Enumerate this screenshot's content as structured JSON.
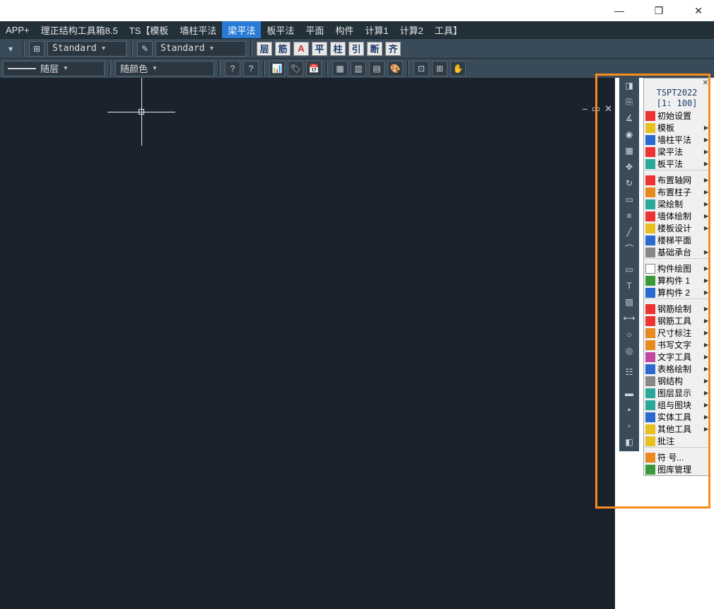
{
  "title_buttons": {
    "min": "—",
    "max": "❐",
    "close": "✕"
  },
  "menu": {
    "items": [
      "APP+",
      "理正结构工具箱8.5",
      "TS【模板",
      "墙柱平法",
      "梁平法",
      "板平法",
      "平面",
      "构件",
      "计算1",
      "计算2",
      "工具】"
    ],
    "active_index": 4
  },
  "toolbar1": {
    "style1": "Standard",
    "style2": "Standard",
    "labels": [
      "层",
      "筋",
      "A",
      "平",
      "柱",
      "引",
      "断",
      "齐"
    ]
  },
  "toolbar2": {
    "layer_line": "———",
    "layer_text": "随层",
    "color_text": "随颜色"
  },
  "canvas": {
    "ctrl_min": "–",
    "ctrl_sq": "▭",
    "ctrl_x": "✕"
  },
  "right_panel": {
    "title": "TSPT2022",
    "scale": "[1: 100]",
    "items": [
      {
        "label": "初始设置",
        "arrow": false,
        "c": "c-red"
      },
      {
        "label": "模板",
        "arrow": true,
        "c": "c-yel"
      },
      {
        "label": "墙柱平法",
        "arrow": true,
        "c": "c-blue"
      },
      {
        "label": "梁平法",
        "arrow": true,
        "c": "c-red"
      },
      {
        "label": "板平法",
        "arrow": true,
        "c": "c-teal"
      }
    ],
    "items2": [
      {
        "label": "布置轴网",
        "arrow": true,
        "c": "c-red"
      },
      {
        "label": "布置柱子",
        "arrow": true,
        "c": "c-ora"
      },
      {
        "label": "梁绘制",
        "arrow": true,
        "c": "c-teal"
      },
      {
        "label": "墙体绘制",
        "arrow": true,
        "c": "c-red"
      },
      {
        "label": "楼板设计",
        "arrow": true,
        "c": "c-yel"
      },
      {
        "label": "楼梯平面",
        "arrow": false,
        "c": "c-blue"
      },
      {
        "label": "基础承台",
        "arrow": true,
        "c": "c-gray"
      }
    ],
    "items3": [
      {
        "label": "构件绘图",
        "arrow": true,
        "c": "c-wht"
      },
      {
        "label": "算构件 1",
        "arrow": true,
        "c": "c-grn"
      },
      {
        "label": "算构件 2",
        "arrow": true,
        "c": "c-blue"
      }
    ],
    "items4": [
      {
        "label": "钢筋绘制",
        "arrow": true,
        "c": "c-red"
      },
      {
        "label": "钢筋工具",
        "arrow": true,
        "c": "c-red"
      },
      {
        "label": "尺寸标注",
        "arrow": true,
        "c": "c-ora"
      },
      {
        "label": "书写文字",
        "arrow": true,
        "c": "c-ora"
      },
      {
        "label": "文字工具",
        "arrow": true,
        "c": "c-mag"
      },
      {
        "label": "表格绘制",
        "arrow": true,
        "c": "c-blue"
      },
      {
        "label": "钢结构",
        "arrow": true,
        "c": "c-gray"
      },
      {
        "label": "图层显示",
        "arrow": true,
        "c": "c-teal"
      },
      {
        "label": "组与图块",
        "arrow": true,
        "c": "c-teal"
      },
      {
        "label": "实体工具",
        "arrow": true,
        "c": "c-blue"
      },
      {
        "label": "其他工具",
        "arrow": true,
        "c": "c-yel"
      },
      {
        "label": "批注",
        "arrow": false,
        "c": "c-yel"
      }
    ],
    "items5": [
      {
        "label": "符 号...",
        "arrow": false,
        "c": "c-ora"
      },
      {
        "label": "图库管理",
        "arrow": false,
        "c": "c-grn"
      }
    ]
  }
}
